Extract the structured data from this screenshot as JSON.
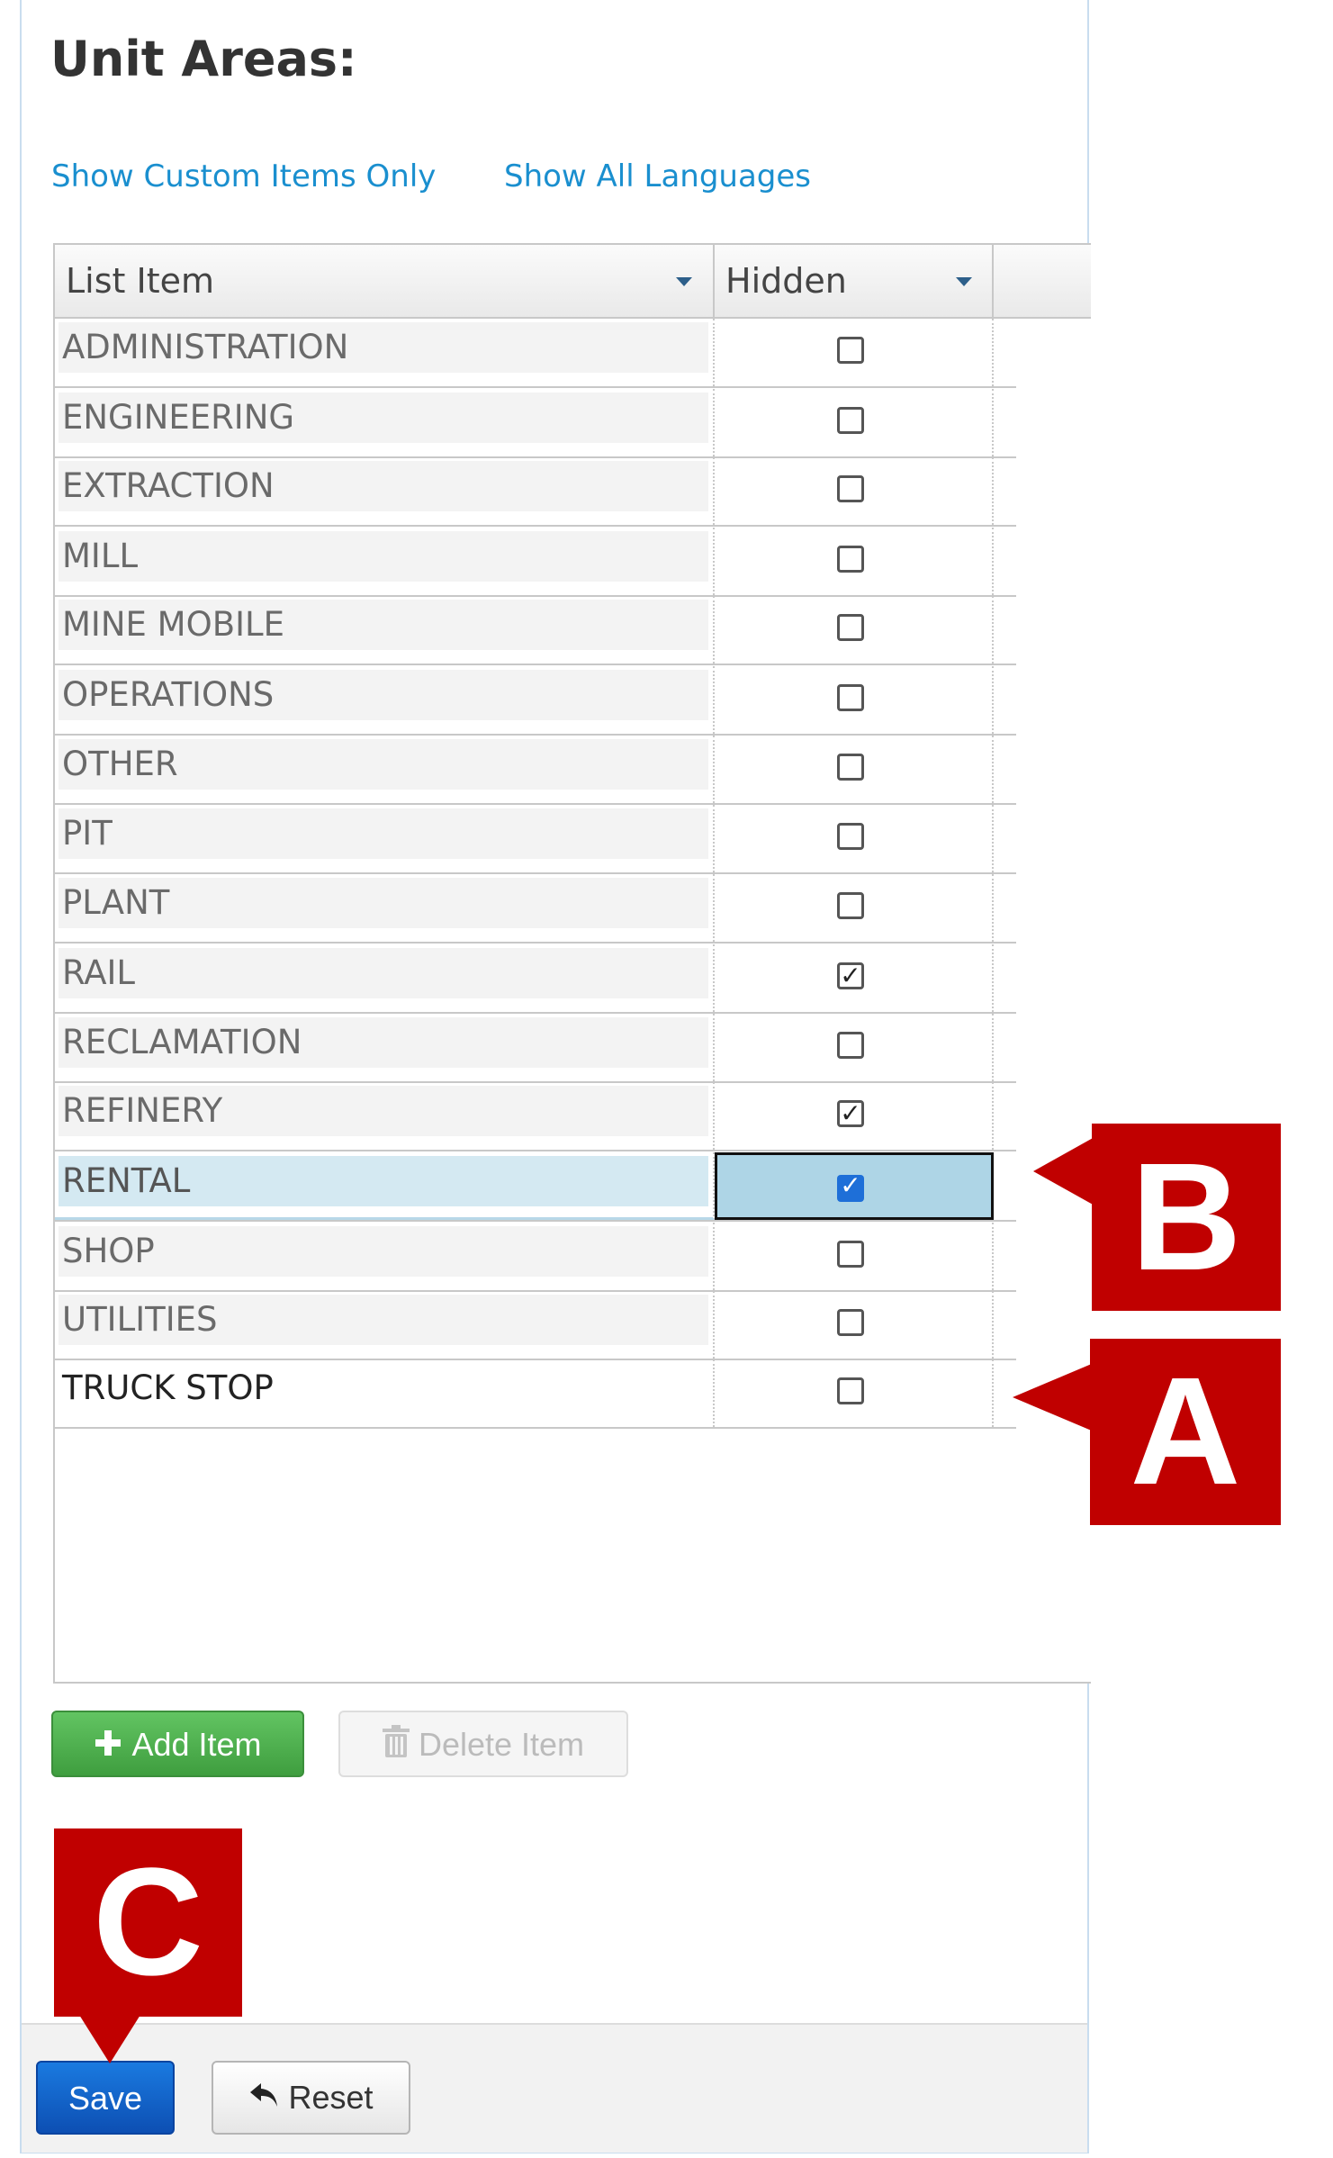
{
  "page": {
    "title": "Unit Areas:",
    "links": {
      "custom_only": "Show Custom Items Only",
      "all_languages": "Show All Languages"
    }
  },
  "grid": {
    "columns": [
      "List Item",
      "Hidden"
    ],
    "rows": [
      {
        "label": "ADMINISTRATION",
        "hidden": false
      },
      {
        "label": "ENGINEERING",
        "hidden": false
      },
      {
        "label": "EXTRACTION",
        "hidden": false
      },
      {
        "label": "MILL",
        "hidden": false
      },
      {
        "label": "MINE MOBILE",
        "hidden": false
      },
      {
        "label": "OPERATIONS",
        "hidden": false
      },
      {
        "label": "OTHER",
        "hidden": false
      },
      {
        "label": "PIT",
        "hidden": false
      },
      {
        "label": "PLANT",
        "hidden": false
      },
      {
        "label": "RAIL",
        "hidden": true
      },
      {
        "label": "RECLAMATION",
        "hidden": false
      },
      {
        "label": "REFINERY",
        "hidden": true
      },
      {
        "label": "RENTAL",
        "hidden": true,
        "selected": true
      },
      {
        "label": "SHOP",
        "hidden": false
      },
      {
        "label": "UTILITIES",
        "hidden": false
      },
      {
        "label": "TRUCK STOP",
        "hidden": false,
        "custom": true
      }
    ]
  },
  "buttons": {
    "add": "Add Item",
    "delete": "Delete Item",
    "save": "Save",
    "reset": "Reset"
  },
  "callouts": {
    "a": "A",
    "b": "B",
    "c": "C"
  },
  "colors": {
    "link": "#1a8fcf",
    "callout": "#c00000",
    "save": "#0d4fb3",
    "add": "#3f9e3f",
    "selected_row": "#d4e9f2"
  },
  "icons": {
    "add": "plus-icon",
    "delete": "trash-icon",
    "reset": "undo-arrow-icon",
    "sort": "caret-down-icon",
    "checkbox": "checkbox-icon"
  }
}
